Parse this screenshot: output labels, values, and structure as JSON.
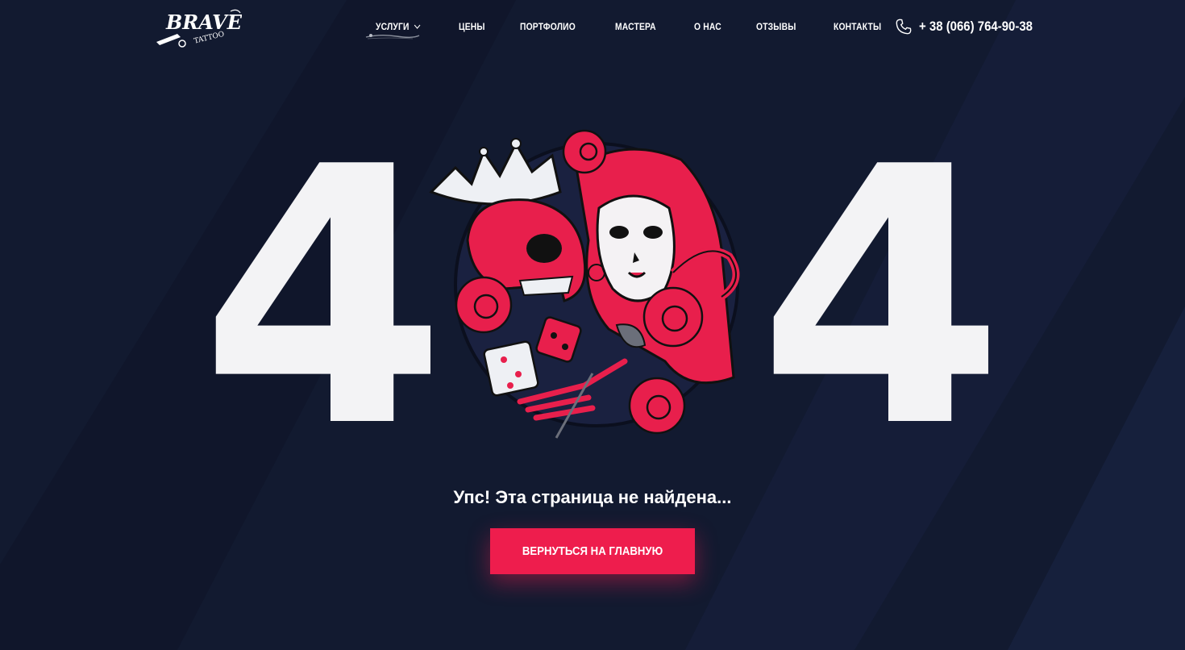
{
  "colors": {
    "background": "#121a30",
    "accent": "#ee1d4d",
    "text": "#ffffff",
    "digit": "#f3f3f5"
  },
  "header": {
    "logo_text": "BRAVE",
    "logo_subtext": "TATTOO",
    "nav": [
      {
        "label": "УСЛУГИ",
        "has_dropdown": true,
        "active": true
      },
      {
        "label": "ЦЕНЫ"
      },
      {
        "label": "ПОРТФОЛИО"
      },
      {
        "label": "МАСТЕРА"
      },
      {
        "label": "О НАС"
      },
      {
        "label": "ОТЗЫВЫ"
      },
      {
        "label": "КОНТАКТЫ"
      }
    ],
    "phone": "+ 38 (066) 764-90-38",
    "phone_icon": "phone-icon"
  },
  "error": {
    "digit_left": "4",
    "digit_right": "4",
    "illustration": "skull-girl-roses-illustration",
    "message": "Упс! Эта страница не найдена...",
    "button_label": "ВЕРНУТЬСЯ НА ГЛАВНУЮ"
  }
}
